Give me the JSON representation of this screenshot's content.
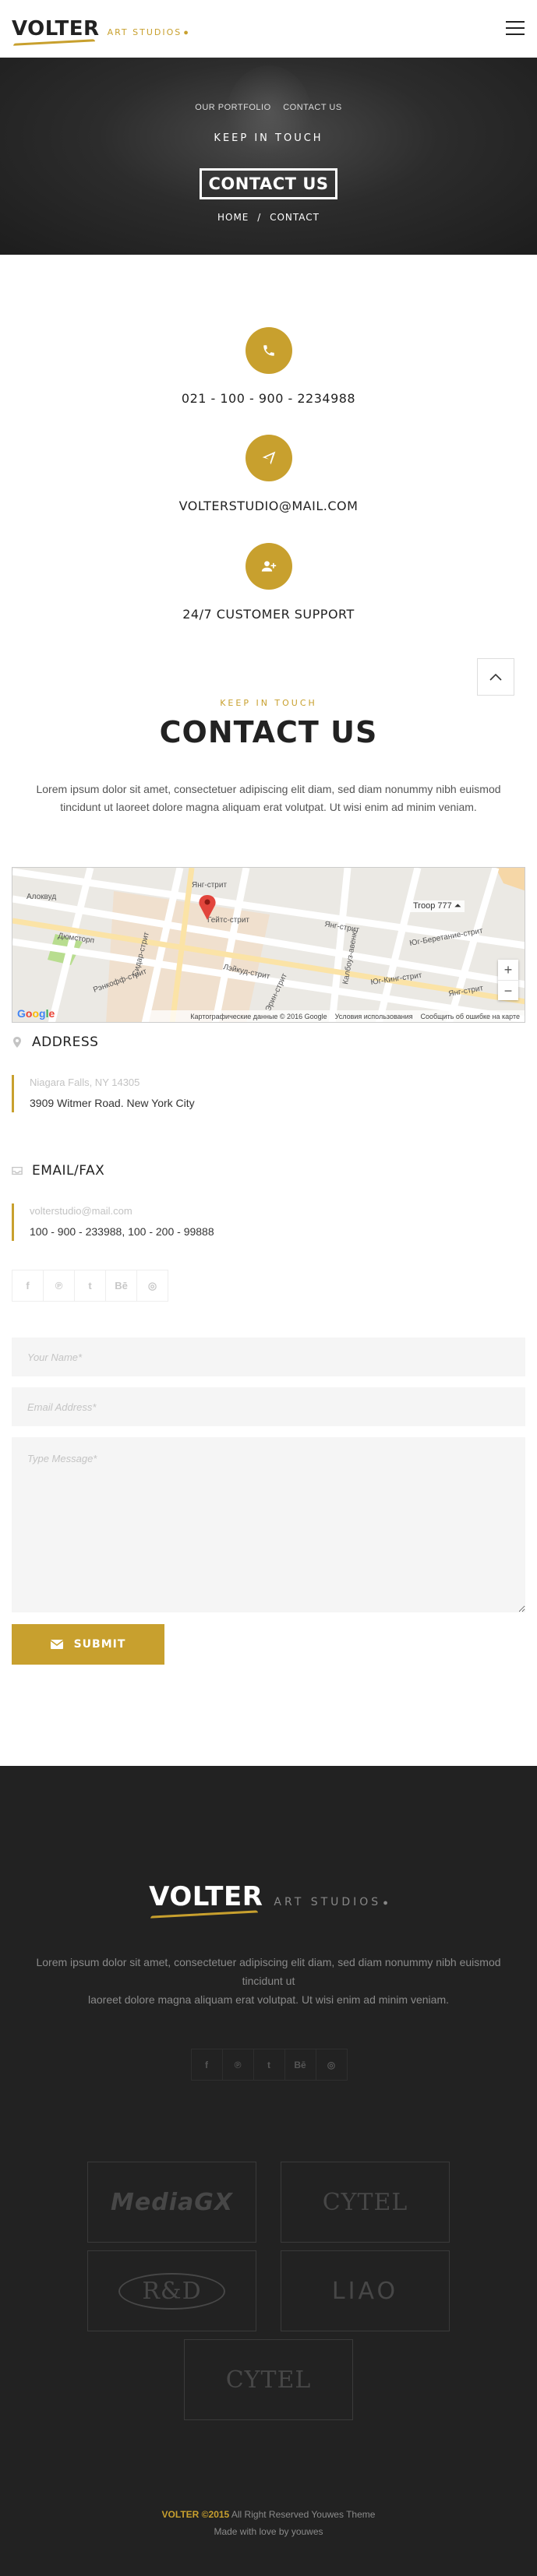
{
  "header": {
    "logo_main": "VOLTER",
    "logo_sub": "ART STUDIOS",
    "menu_icon": "hamburger-icon"
  },
  "hero": {
    "breadcrumb_top": [
      "OUR PORTFOLIO",
      "CONTACT US"
    ],
    "subtitle": "KEEP IN TOUCH",
    "title": "CONTACT US",
    "crumb_home": "HOME",
    "crumb_sep": "/",
    "crumb_current": "CONTACT"
  },
  "info": [
    {
      "icon": "phone-icon",
      "text": "021 - 100 - 900 - 2234988"
    },
    {
      "icon": "paper-plane-icon",
      "text": "VOLTERSTUDIO@MAIL.COM"
    },
    {
      "icon": "user-plus-icon",
      "text": "24/7 CUSTOMER SUPPORT"
    }
  ],
  "contact": {
    "kicker": "KEEP IN TOUCH",
    "title": "CONTACT US",
    "description": "Lorem ipsum dolor sit amet, consectetuer adipiscing elit diam, sed diam nonummy nibh euismod tincidunt ut laoreet dolore magna aliquam erat volutpat. Ut wisi enim ad minim veniam."
  },
  "map": {
    "place_label": "Troop 777",
    "zoom_in": "+",
    "zoom_out": "−",
    "attribution": "Картографические данные © 2016 Google",
    "terms": "Условия использования",
    "report": "Сообщить об ошибке на карте",
    "streets": [
      "Алоквуд",
      "Дюмсторп",
      "Рэнкофф-стрит",
      "Сидар-стрит",
      "Гейтс-стрит",
      "Янг-стрит",
      "Янг-стрит",
      "Лэйкуд-стрит",
      "Эрин-стрит",
      "Калбоуз-авеню",
      "Юг-Беретание-стрит",
      "Юг-Кинг-стрит",
      "Янг-стрит"
    ]
  },
  "address": {
    "title": "ADDRESS",
    "icon": "map-pin-icon",
    "line1": "Niagara Falls, NY 14305",
    "line2": "3909 Witmer Road. New York City"
  },
  "email_fax": {
    "title": "EMAIL/FAX",
    "icon": "inbox-icon",
    "line1": "volterstudio@mail.com",
    "line2": "100 - 900 - 233988, 100 - 200 - 99888"
  },
  "social": [
    {
      "icon": "facebook-icon",
      "glyph": "f"
    },
    {
      "icon": "pinterest-icon",
      "glyph": "℗"
    },
    {
      "icon": "twitter-icon",
      "glyph": "t"
    },
    {
      "icon": "behance-icon",
      "glyph": "Bē"
    },
    {
      "icon": "dribbble-icon",
      "glyph": "◎"
    }
  ],
  "form": {
    "name_placeholder": "Your Name*",
    "email_placeholder": "Email Address*",
    "message_placeholder": "Type Message*",
    "submit_label": "SUBMIT"
  },
  "footer": {
    "logo_main": "VOLTER",
    "logo_sub": "ART STUDIOS",
    "description_line1": "Lorem ipsum dolor sit amet, consectetuer adipiscing elit diam, sed diam nonummy nibh euismod tincidunt ut",
    "description_line2": "laoreet dolore magna aliquam erat volutpat. Ut wisi enim ad minim veniam.",
    "brands": [
      "MediaGX",
      "CYTEL",
      "R&D",
      "LIAO",
      "CYTEL"
    ],
    "copy_brand": "VOLTER",
    "copy_year": "©2015",
    "copy_rest": "All Right Reserved Youwes Theme",
    "made_with": "Made with love by youwes"
  },
  "colors": {
    "accent": "#c8a02e",
    "dark": "#222222"
  }
}
